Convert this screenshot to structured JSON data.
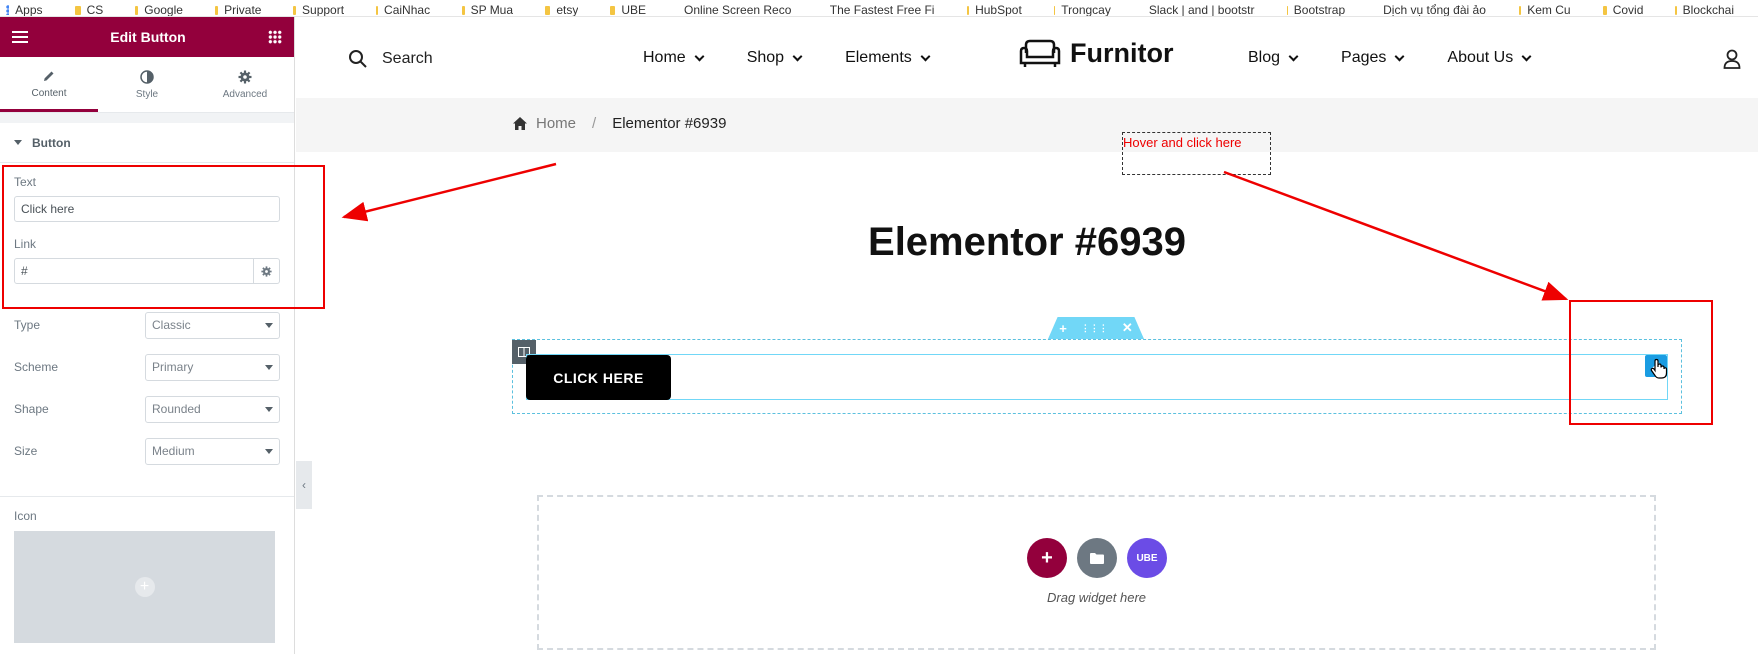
{
  "bookmarks": [
    "Apps",
    "CS",
    "Google",
    "Private",
    "Support",
    "CaiNhac",
    "SP Mua",
    "etsy",
    "UBE",
    "Online Screen Reco...",
    "The Fastest Free Fi...",
    "HubSpot",
    "Trongcay",
    "Slack | and | bootstr...",
    "Bootstrap",
    "Dịch vụ tổng đài ảo...",
    "Kem Cu",
    "Covid",
    "Blockchai"
  ],
  "panel": {
    "title": "Edit Button",
    "tabs": [
      {
        "label": "Content",
        "icon": "pencil-icon"
      },
      {
        "label": "Style",
        "icon": "contrast-icon"
      },
      {
        "label": "Advanced",
        "icon": "gear-icon"
      }
    ],
    "section_title": "Button",
    "text_label": "Text",
    "text_value": "Click here",
    "link_label": "Link",
    "link_value": "#",
    "type": {
      "label": "Type",
      "value": "Classic"
    },
    "scheme": {
      "label": "Scheme",
      "value": "Primary"
    },
    "shape": {
      "label": "Shape",
      "value": "Rounded"
    },
    "size": {
      "label": "Size",
      "value": "Medium"
    },
    "icon_label": "Icon",
    "accent": "#93003c"
  },
  "site": {
    "search_label": "Search",
    "nav_left": [
      "Home",
      "Shop",
      "Elements"
    ],
    "logo": "Furnitor",
    "nav_right": [
      "Blog",
      "Pages",
      "About Us"
    ],
    "breadcrumb_home": "Home",
    "breadcrumb_sep": "/",
    "breadcrumb_current": "Elementor #6939",
    "page_title": "Elementor #6939"
  },
  "editor": {
    "button_text": "CLICK HERE",
    "handle_add": "+",
    "handle_move": "⋮⋮⋮",
    "handle_close": "✕",
    "drag_text": "Drag widget here",
    "dz_add": "+",
    "dz_ube": "UBE"
  },
  "annotation": {
    "hint": "Hover and click here",
    "color": "#e00000"
  }
}
